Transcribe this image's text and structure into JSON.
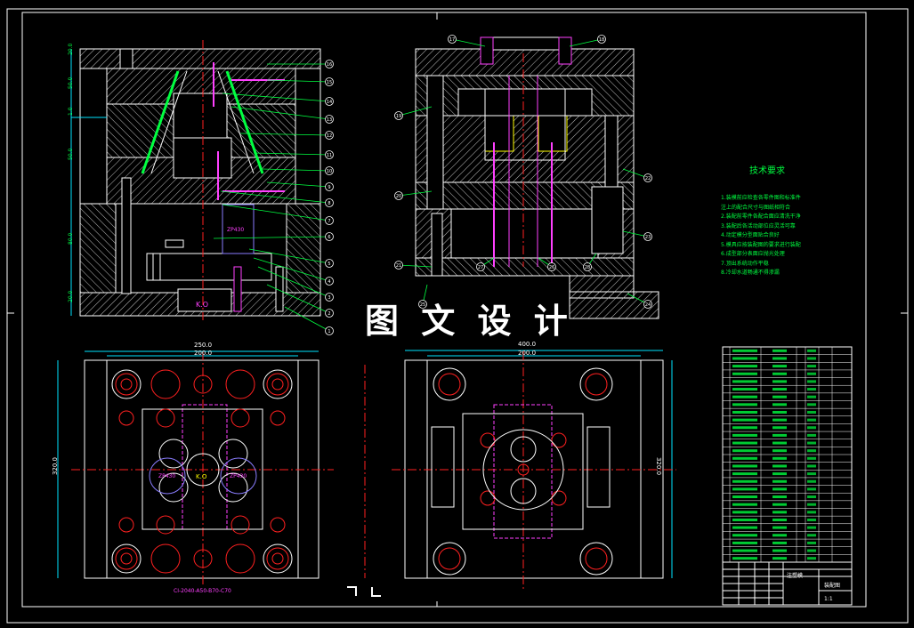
{
  "drawing": {
    "watermark": "图 文 设 计",
    "tech_req": {
      "title": "技术要求",
      "lines": [
        "1.装模前应检查各零件图和标准件",
        "注上的配合尺寸与图纸相符合",
        "2.装配前零件各配合面应清洗干净",
        "3.装配后各活动部位应灵活可靠",
        "4.动定模分型面贴合良好",
        "5.模具应按装配图的要求进行装配",
        "6.成型部分表面应抛光处理",
        "7.顶出系统动作平稳",
        "8.冷却水道畅通不得渗漏"
      ]
    },
    "dimensions": {
      "front_left": [
        "20.0",
        "50.0",
        "1.0",
        "50.0",
        "80.0",
        "20.0"
      ],
      "top_left_width_outer": "250.0",
      "top_left_width_inner": "200.0",
      "top_left_height": "320.0",
      "top_right_width_outer": "400.0",
      "top_right_width_inner": "200.0",
      "top_right_height": "320.0"
    },
    "labels": {
      "cavity_note_1": "ZP430",
      "cavity_note_2": "ZP430",
      "cavity_note_3": "ZP430",
      "ko_label": "K.O",
      "ko_label_2": "K.O",
      "caption_left": "CI-2040-A50-B70-C70",
      "title_block_name": "注塑模",
      "title_block_drawing": "装配图",
      "title_block_scale": "1:1"
    },
    "balloon_labels_left": [
      "1",
      "2",
      "3",
      "4",
      "5",
      "6",
      "7",
      "8",
      "9",
      "10",
      "11",
      "12",
      "13",
      "14",
      "15",
      "16"
    ],
    "balloon_labels_right": [
      "17",
      "18",
      "19",
      "20",
      "21",
      "22",
      "23",
      "24",
      "25",
      "26",
      "27",
      "28"
    ],
    "colors": {
      "background": "#000000",
      "frame": "#ffffff",
      "outline": "#ffffff",
      "centerline": "#ff2020",
      "hatch": "#cfcfcf",
      "dimension": "#00e5ff",
      "leader": "#00ff40",
      "magenta": "#ff40ff",
      "yellow": "#ffff00",
      "purple": "#8a7dff",
      "bom_green": "#00ff40"
    }
  }
}
